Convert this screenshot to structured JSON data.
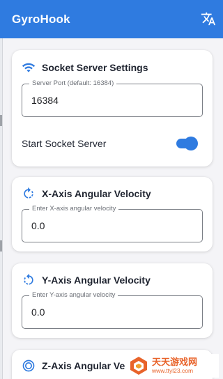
{
  "app": {
    "title": "GyroHook"
  },
  "colors": {
    "primary": "#2f7be0",
    "background": "#f4f4f7",
    "card": "#ffffff",
    "watermark": "#e8632a"
  },
  "socket_card": {
    "icon": "wifi-icon",
    "title": "Socket Server Settings",
    "port_label": "Server Port (default: 16384)",
    "port_value": "16384",
    "switch_label": "Start Socket Server",
    "switch_on": true
  },
  "x_card": {
    "icon": "rotate-cw-icon",
    "title": "X-Axis Angular Velocity",
    "input_label": "Enter X-axis angular velocity",
    "input_value": "0.0"
  },
  "y_card": {
    "icon": "rotate-ccw-icon",
    "title": "Y-Axis Angular Velocity",
    "input_label": "Enter Y-axis angular velocity",
    "input_value": "0.0"
  },
  "z_card": {
    "icon": "target-icon",
    "title": "Z-Axis Angular Ve"
  },
  "watermark": {
    "main": "天天游戏网",
    "sub": "www.ttyl23.com"
  }
}
